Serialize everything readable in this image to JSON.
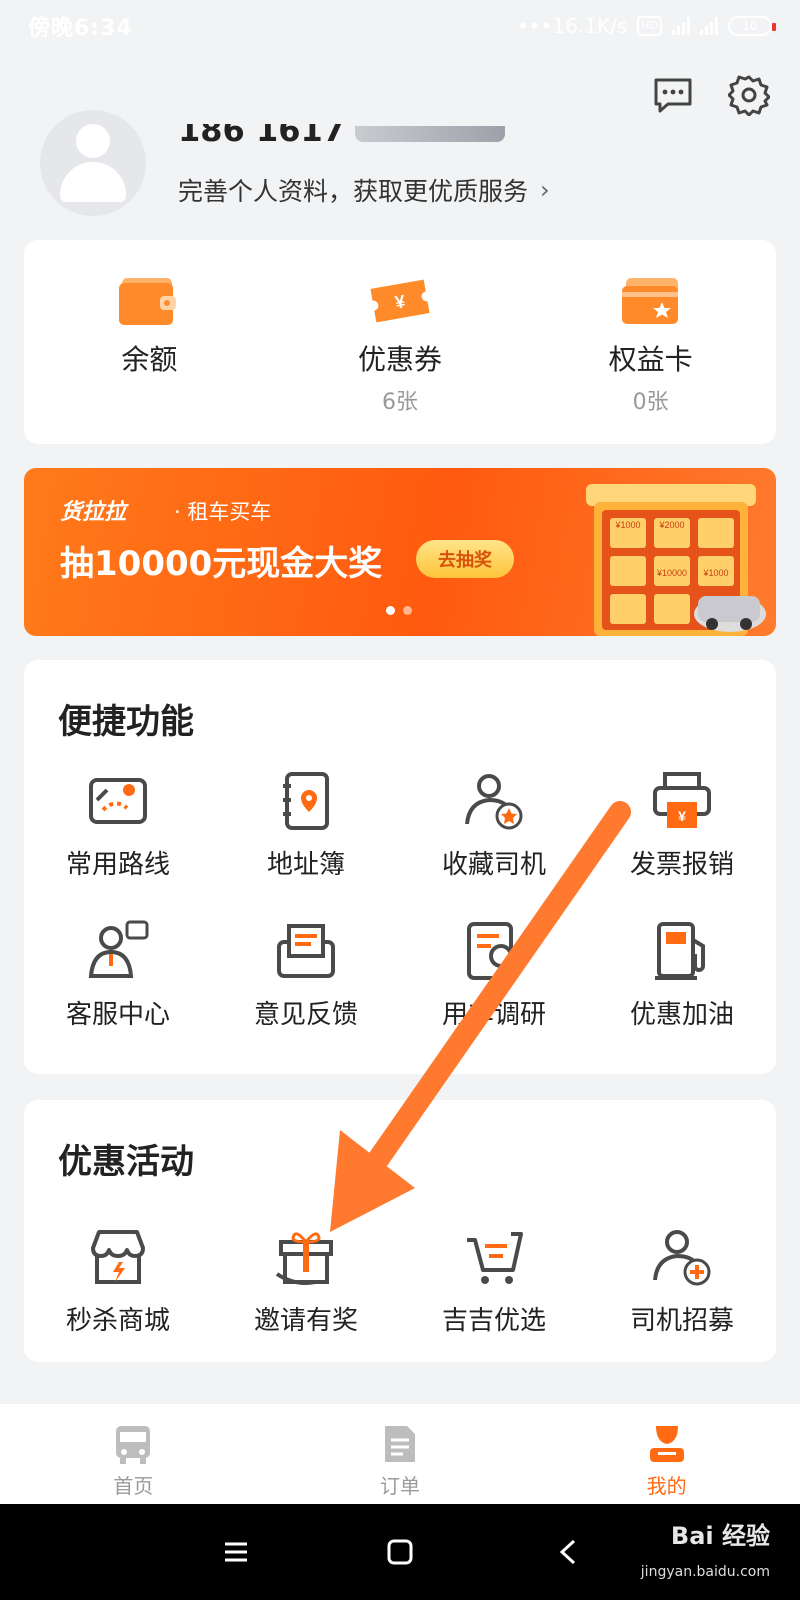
{
  "status_bar": {
    "time": "傍晚6:34",
    "network_speed": "•••16.1K/s",
    "hd_badge": "HD",
    "network_type": "4G",
    "battery": "10"
  },
  "header": {
    "message_icon": "message-icon",
    "settings_icon": "gear-icon"
  },
  "profile": {
    "phone": "186 1617",
    "tip": "完善个人资料，获取更优质服务",
    "chevron": "›"
  },
  "assets": [
    {
      "label": "余额",
      "sub": "",
      "icon": "wallet-icon"
    },
    {
      "label": "优惠券",
      "sub": "6张",
      "icon": "coupon-icon"
    },
    {
      "label": "权益卡",
      "sub": "0张",
      "icon": "card-icon"
    }
  ],
  "banner": {
    "brand": "货拉拉",
    "brand_sub": "· 租车买车",
    "headline": "抽10000元现金大奖",
    "cta": "去抽奖",
    "prizes": [
      "¥1000",
      "¥2000",
      "¥10000",
      "¥1000"
    ]
  },
  "quick": {
    "title": "便捷功能",
    "row1": [
      {
        "label": "常用路线",
        "icon": "route-map-icon"
      },
      {
        "label": "地址簿",
        "icon": "address-book-icon"
      },
      {
        "label": "收藏司机",
        "icon": "favorite-driver-icon"
      },
      {
        "label": "发票报销",
        "icon": "invoice-printer-icon"
      }
    ],
    "row2": [
      {
        "label": "客服中心",
        "icon": "customer-service-icon"
      },
      {
        "label": "意见反馈",
        "icon": "feedback-mail-icon"
      },
      {
        "label": "用车调研",
        "icon": "survey-icon"
      },
      {
        "label": "优惠加油",
        "icon": "fuel-pump-icon"
      }
    ]
  },
  "promo": {
    "title": "优惠活动",
    "items": [
      {
        "label": "秒杀商城",
        "icon": "flash-sale-store-icon"
      },
      {
        "label": "邀请有奖",
        "icon": "gift-invite-icon"
      },
      {
        "label": "吉吉优选",
        "icon": "shopping-cart-icon"
      },
      {
        "label": "司机招募",
        "icon": "driver-recruit-icon"
      }
    ]
  },
  "tabs": [
    {
      "label": "首页",
      "icon": "truck-icon",
      "active": false
    },
    {
      "label": "订单",
      "icon": "order-list-icon",
      "active": false
    },
    {
      "label": "我的",
      "icon": "profile-icon",
      "active": true
    }
  ],
  "watermark": {
    "brand": "Bai 经验",
    "url": "jingyan.baidu.com"
  },
  "colors": {
    "accent": "#ff6a13",
    "icon_dark": "#4a4a4a",
    "background": "#f2f3f5",
    "arrow": "#ff7a2e"
  }
}
